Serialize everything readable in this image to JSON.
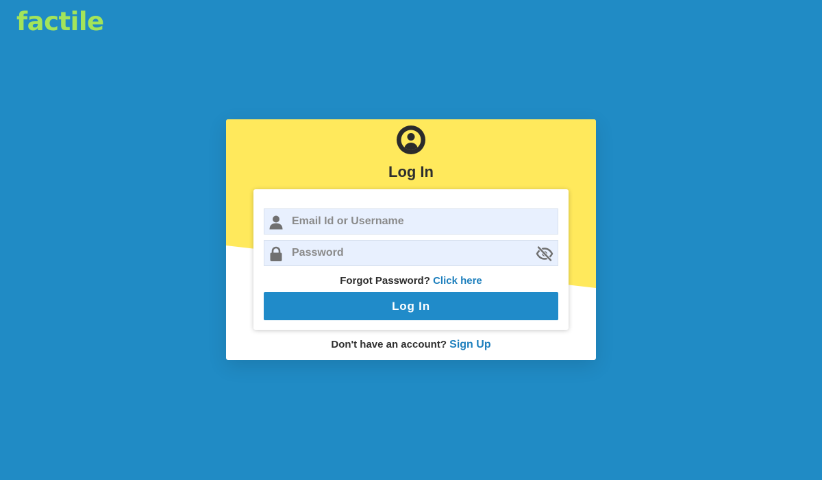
{
  "brand": {
    "logo_text": "factile",
    "logo_color": "#a3e45a"
  },
  "colors": {
    "page_background": "#208bc5",
    "card_accent": "#ffe95c",
    "primary_button": "#208bc9",
    "link": "#1d7fbd",
    "input_background": "#e8f0fe"
  },
  "login": {
    "title": "Log In",
    "avatar_icon": "user-circle-icon",
    "username": {
      "icon": "user-icon",
      "placeholder": "Email Id or Username",
      "value": ""
    },
    "password": {
      "icon": "lock-icon",
      "placeholder": "Password",
      "value": "",
      "toggle_icon": "eye-slash-icon"
    },
    "forgot_text": "Forgot Password?",
    "forgot_link": "Click here",
    "submit_label": "Log In",
    "signup_text": "Don't have an account?",
    "signup_link": "Sign Up"
  }
}
